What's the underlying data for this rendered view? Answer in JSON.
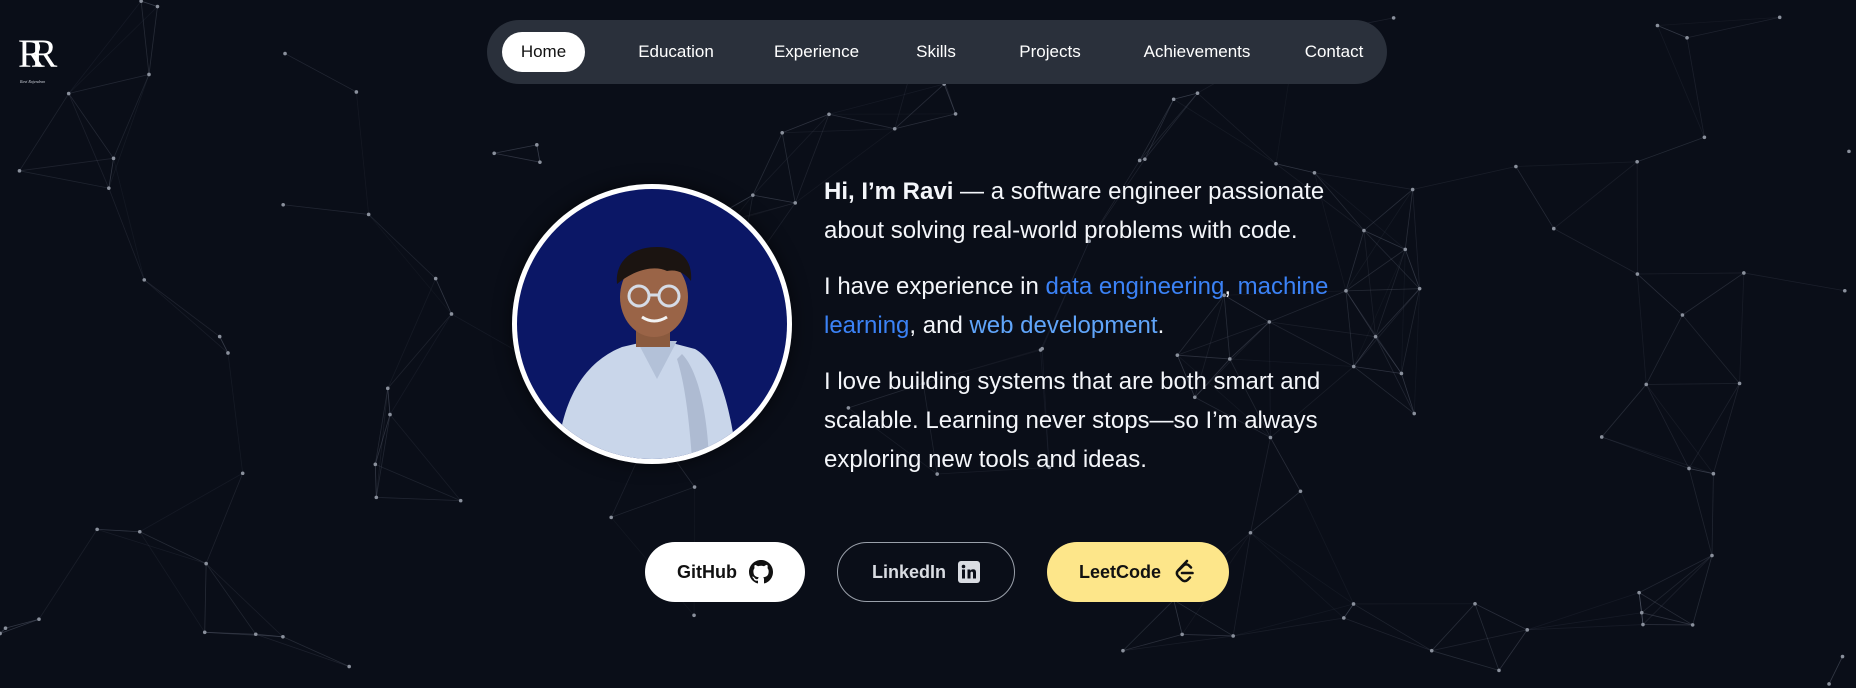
{
  "logo": {
    "monogram": "RR",
    "signature": "Ravi Rajendran"
  },
  "nav": {
    "items": [
      {
        "label": "Home",
        "active": true
      },
      {
        "label": "Education",
        "active": false
      },
      {
        "label": "Experience",
        "active": false
      },
      {
        "label": "Skills",
        "active": false
      },
      {
        "label": "Projects",
        "active": false
      },
      {
        "label": "Achievements",
        "active": false
      },
      {
        "label": "Contact",
        "active": false
      }
    ]
  },
  "intro": {
    "greeting": "Hi, I’m Ravi",
    "tagline": " — a software engineer passionate about solving real-world problems with code.",
    "exp_prefix": "I have experience in ",
    "skill_1": "data engineering",
    "sep_1": ", ",
    "skill_2": "machine learning",
    "sep_2": ", and ",
    "skill_3": "web development",
    "exp_suffix": ".",
    "paragraph_3": "I love building systems that are both smart and scalable. Learning never stops—so I’m always exploring new tools and ideas."
  },
  "buttons": {
    "github": "GitHub",
    "linkedin": "LinkedIn",
    "leetcode": "LeetCode"
  },
  "icons": {
    "github": "github-icon",
    "linkedin": "linkedin-icon",
    "leetcode": "leetcode-icon"
  },
  "colors": {
    "background": "#0a0e18",
    "nav_bg": "#2a303b",
    "avatar_bg": "#0b1766",
    "link_blue": "#3b82f6",
    "leetcode_yellow": "#fde68a"
  }
}
